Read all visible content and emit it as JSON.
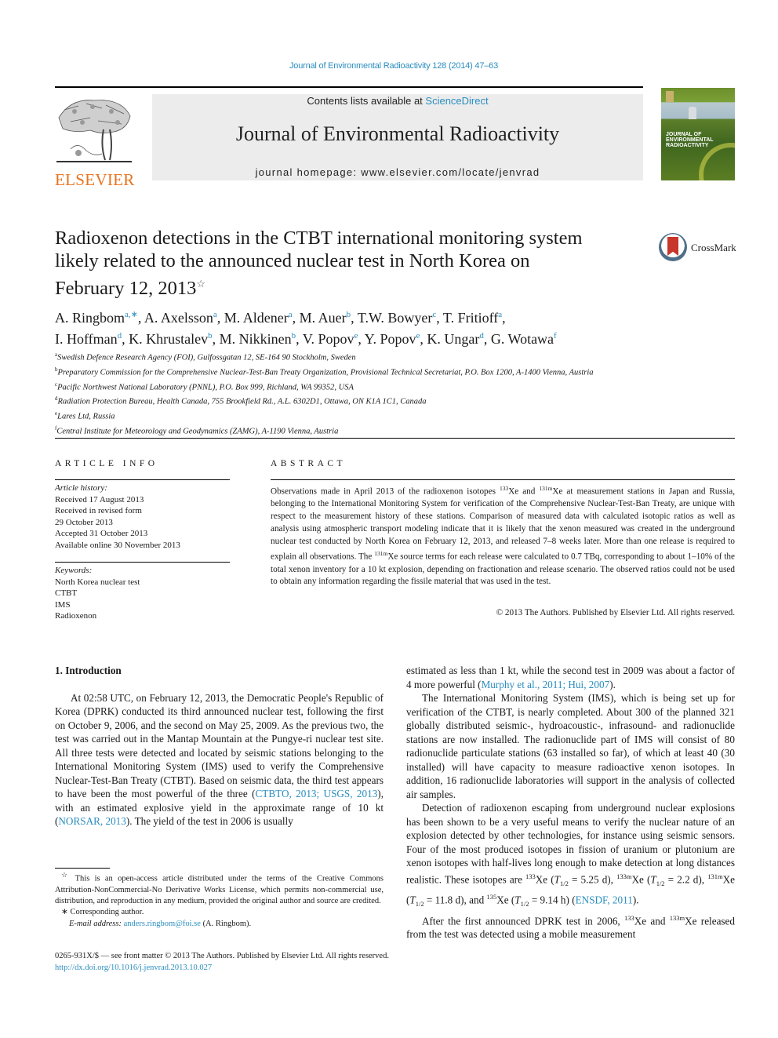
{
  "header": {
    "journal_ref": "Journal of Environmental Radioactivity 128 (2014) 47–63",
    "contents_prefix": "Contents lists available at ",
    "contents_link": "ScienceDirect",
    "journal_title": "Journal of Environmental Radioactivity",
    "homepage_label": "journal homepage: ",
    "homepage_url": "www.elsevier.com/locate/jenvrad",
    "publisher_logo_text": "ELSEVIER",
    "cover_text_line1": "JOURNAL OF",
    "cover_text_line2": "ENVIRONMENTAL",
    "cover_text_line3": "RADIOACTIVITY",
    "colors": {
      "link": "#2a8dbf",
      "elsevier_orange": "#e8731e",
      "banner_bg": "#ececec"
    }
  },
  "article": {
    "title_line1": "Radioxenon detections in the CTBT international monitoring system",
    "title_line2": "likely related to the announced nuclear test in North Korea on",
    "title_line3": "February 12, 2013",
    "title_mark": "☆",
    "crossmark_label": "CrossMark",
    "authors_line1": [
      {
        "name": "A. Ringbom",
        "aff": "a,∗"
      },
      {
        "name": "A. Axelsson",
        "aff": "a"
      },
      {
        "name": "M. Aldener",
        "aff": "a"
      },
      {
        "name": "M. Auer",
        "aff": "b"
      },
      {
        "name": "T.W. Bowyer",
        "aff": "c"
      },
      {
        "name": "T. Fritioff",
        "aff": "a"
      }
    ],
    "authors_line2": [
      {
        "name": "I. Hoffman",
        "aff": "d"
      },
      {
        "name": "K. Khrustalev",
        "aff": "b"
      },
      {
        "name": "M. Nikkinen",
        "aff": "b"
      },
      {
        "name": "V. Popov",
        "aff": "e"
      },
      {
        "name": "Y. Popov",
        "aff": "e"
      },
      {
        "name": "K. Ungar",
        "aff": "d"
      },
      {
        "name": "G. Wotawa",
        "aff": "f"
      }
    ],
    "affiliations": [
      {
        "key": "a",
        "text": "Swedish Defence Research Agency (FOI), Gulfossgatan 12, SE-164 90 Stockholm, Sweden"
      },
      {
        "key": "b",
        "text": "Preparatory Commission for the Comprehensive Nuclear-Test-Ban Treaty Organization, Provisional Technical Secretariat, P.O. Box 1200, A-1400 Vienna, Austria"
      },
      {
        "key": "c",
        "text": "Pacific Northwest National Laboratory (PNNL), P.O. Box 999, Richland, WA 99352, USA"
      },
      {
        "key": "d",
        "text": "Radiation Protection Bureau, Health Canada, 755 Brookfield Rd., A.L. 6302D1, Ottawa, ON K1A 1C1, Canada"
      },
      {
        "key": "e",
        "text": "Lares Ltd, Russia"
      },
      {
        "key": "f",
        "text": "Central Institute for Meteorology and Geodynamics (ZAMG), A-1190 Vienna, Austria"
      }
    ]
  },
  "article_info": {
    "heading": "ARTICLE INFO",
    "history_label": "Article history:",
    "history": [
      "Received 17 August 2013",
      "Received in revised form",
      "29 October 2013",
      "Accepted 31 October 2013",
      "Available online 30 November 2013"
    ],
    "keywords_label": "Keywords:",
    "keywords": [
      "North Korea nuclear test",
      "CTBT",
      "IMS",
      "Radioxenon"
    ]
  },
  "abstract": {
    "heading": "ABSTRACT",
    "p1_a": "Observations made in April 2013 of the radioxenon isotopes ",
    "iso1": "133",
    "p1_b": "Xe and ",
    "iso2": "131m",
    "p1_c": "Xe at measurement stations in Japan and Russia, belonging to the International Monitoring System for verification of the Comprehensive Nuclear-Test-Ban Treaty, are unique with respect to the measurement history of these stations. Comparison of measured data with calculated isotopic ratios as well as analysis using atmospheric transport modeling indicate that it is likely that the xenon measured was created in the underground nuclear test conducted by North Korea on February 12, 2013, and released 7–8 weeks later. More than one release is required to explain all observations. The ",
    "iso3": "131m",
    "p1_d": "Xe source terms for each release were calculated to 0.7 TBq, corresponding to about 1–10% of the total xenon inventory for a 10 kt explosion, depending on fractionation and release scenario. The observed ratios could not be used to obtain any information regarding the fissile material that was used in the test.",
    "copyright": "© 2013 The Authors. Published by Elsevier Ltd. All rights reserved."
  },
  "body": {
    "section_title": "1.  Introduction",
    "left_p1_a": "At 02:58 UTC, on February 12, 2013, the Democratic People's Republic of Korea (DPRK) conducted its third announced nuclear test, following the first on October 9, 2006, and the second on May 25, 2009. As the previous two, the test was carried out in the Mantap Mountain at the Pungye-ri nuclear test site. All three tests were detected and located by seismic stations belonging to the International Monitoring System (IMS) used to verify the Comprehensive Nuclear-Test-Ban Treaty (CTBT). Based on seismic data, the third test appears to have been the most powerful of the three (",
    "left_cite1": "CTBTO, 2013; USGS, 2013",
    "left_p1_b": "), with an estimated explosive yield in the approximate range of 10 kt (",
    "left_cite2": "NORSAR, 2013",
    "left_p1_c": "). The yield of the test in 2006 is usually",
    "right_p1_a": "estimated as less than 1 kt, while the second test in 2009 was about a factor of 4 more powerful (",
    "right_cite1": "Murphy et al., 2011; Hui, 2007",
    "right_p1_b": ").",
    "right_p2": "The International Monitoring System (IMS), which is being set up for verification of the CTBT, is nearly completed. About 300 of the planned 321 globally distributed seismic-, hydroacoustic-, infrasound- and radionuclide stations are now installed. The radionuclide part of IMS will consist of 80 radionuclide particulate stations (63 installed so far), of which at least 40 (30 installed) will have capacity to measure radioactive xenon isotopes. In addition, 16 radionuclide laboratories will support in the analysis of collected air samples.",
    "right_p3_a": "Detection of radioxenon escaping from underground nuclear explosions has been shown to be a very useful means to verify the nuclear nature of an explosion detected by other technologies, for instance using seismic sensors. Four of the most produced isotopes in fission of uranium or plutonium are xenon isotopes with half-lives long enough to make detection at long distances realistic. These isotopes are ",
    "xe133": "133",
    "hl1": " = 5.25 d), ",
    "xe133m": "133m",
    "hl2": " = 2.2 d), ",
    "xe131m": "131m",
    "hl3": " = 11.8 d), and ",
    "xe135": "135",
    "hl4": " = 9.14 h) (",
    "right_cite2": "ENSDF, 2011",
    "right_p4_a": "After the first announced DPRK test in 2006, ",
    "right_p4_b": "Xe and ",
    "right_p4_c": "Xe released from the test was detected using a mobile measurement"
  },
  "footnotes": {
    "open_access_mark": "☆",
    "open_access": " This is an open-access article distributed under the terms of the Creative Commons Attribution-NonCommercial-No Derivative Works License, which permits non-commercial use, distribution, and reproduction in any medium, provided the original author and source are credited.",
    "corresponding_mark": "∗",
    "corresponding": " Corresponding author.",
    "email_label": "E-mail address: ",
    "email": "anders.ringbom@foi.se",
    "email_suffix": " (A. Ringbom)."
  },
  "bottom": {
    "issn_line": "0265-931X/$ — see front matter © 2013 The Authors. Published by Elsevier Ltd. All rights reserved.",
    "doi": "http://dx.doi.org/10.1016/j.jenvrad.2013.10.027"
  }
}
